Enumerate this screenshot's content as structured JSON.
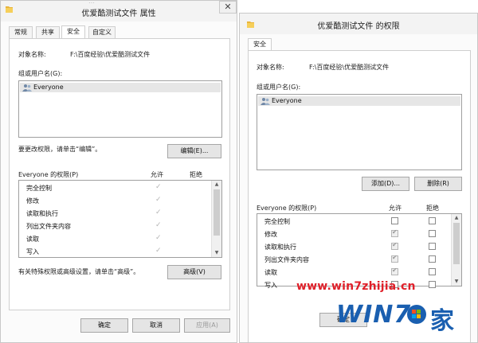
{
  "left": {
    "title": "优爱酷测试文件 属性",
    "titlebar_partial": "…",
    "tabs": [
      {
        "label": "常规"
      },
      {
        "label": "共享"
      },
      {
        "label": "安全"
      },
      {
        "label": "自定义"
      }
    ],
    "object_name_label": "对象名称:",
    "object_name_value": "F:\\百度经验\\优爱酷测试文件",
    "group_label": "组或用户名(G):",
    "group_entries": [
      "Everyone"
    ],
    "change_hint": "要更改权限，请单击“编辑”。",
    "edit_button": "编辑(E)...",
    "perm_label": "Everyone 的权限(P)",
    "allow_header": "允许",
    "deny_header": "拒绝",
    "permissions": [
      "完全控制",
      "修改",
      "读取和执行",
      "列出文件夹内容",
      "读取",
      "写入"
    ],
    "advanced_hint": "有关特殊权限或高级设置，请单击“高级”。",
    "advanced_button": "高级(V)",
    "ok_button": "确定",
    "cancel_button": "取消",
    "apply_button": "应用(A)"
  },
  "right": {
    "title": "优爱酷测试文件 的权限",
    "tab_security": "安全",
    "object_name_label": "对象名称:",
    "object_name_value": "F:\\百度经验\\优爱酷测试文件",
    "group_label": "组或用户名(G):",
    "group_entries": [
      "Everyone"
    ],
    "add_button": "添加(D)...",
    "remove_button": "删除(R)",
    "perm_label": "Everyone 的权限(P)",
    "allow_header": "允许",
    "deny_header": "拒绝",
    "permissions": [
      "完全控制",
      "修改",
      "读取和执行",
      "列出文件夹内容",
      "读取",
      "写入"
    ],
    "allow_checked": [
      false,
      true,
      true,
      true,
      true,
      false
    ],
    "deny_checked": [
      false,
      false,
      false,
      false,
      false,
      false
    ],
    "ok_button": "确定"
  },
  "watermark": {
    "url": "www.win7zhijia.cn",
    "logo_text": "WIN7",
    "logo_suffix": "家",
    "url_color": "#e0202a",
    "logo_color": "#1a5fb0"
  },
  "icons": [
    "folder-icon",
    "close-icon",
    "user-group-icon",
    "checkmark-icon",
    "scroll-up-icon",
    "scroll-down-icon"
  ]
}
